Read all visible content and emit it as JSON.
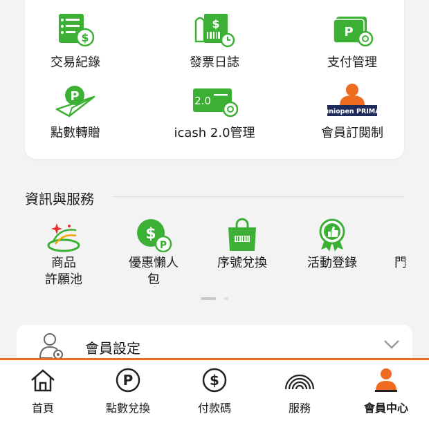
{
  "top_grid": [
    {
      "label": "交易紀錄",
      "icon": "transaction-record-icon"
    },
    {
      "label": "發票日誌",
      "icon": "invoice-log-icon"
    },
    {
      "label": "支付管理",
      "icon": "payment-management-icon"
    },
    {
      "label": "點數轉贈",
      "icon": "points-transfer-icon"
    },
    {
      "label": "icash 2.0管理",
      "icon": "icash-card-icon",
      "card_text": "2.0"
    },
    {
      "label": "會員訂閱制",
      "icon": "membership-subscription-icon",
      "badge_text": "uniopen PRIMA"
    }
  ],
  "services": {
    "title": "資訊與服務",
    "items": [
      {
        "label": "商品\n許願池",
        "icon": "wish-pool-icon"
      },
      {
        "label": "優惠懶人\n包",
        "icon": "discount-pack-icon"
      },
      {
        "label": "序號兌換",
        "icon": "serial-redeem-icon"
      },
      {
        "label": "活動登錄",
        "icon": "event-register-icon"
      },
      {
        "label": "門",
        "icon": "store-icon"
      }
    ],
    "page_indicator": {
      "current": 1,
      "total": 2
    }
  },
  "settings": {
    "label": "會員設定"
  },
  "tabbar": {
    "items": [
      {
        "label": "首頁",
        "icon": "home-icon"
      },
      {
        "label": "點數兌換",
        "icon": "points-icon"
      },
      {
        "label": "付款碼",
        "icon": "payment-code-icon"
      },
      {
        "label": "服務",
        "icon": "service-icon"
      },
      {
        "label": "會員中心",
        "icon": "member-center-icon"
      }
    ],
    "active": "會員中心",
    "accent": "#ee6b20"
  },
  "colors": {
    "green": "#3cb034",
    "orange": "#ee6b20"
  }
}
